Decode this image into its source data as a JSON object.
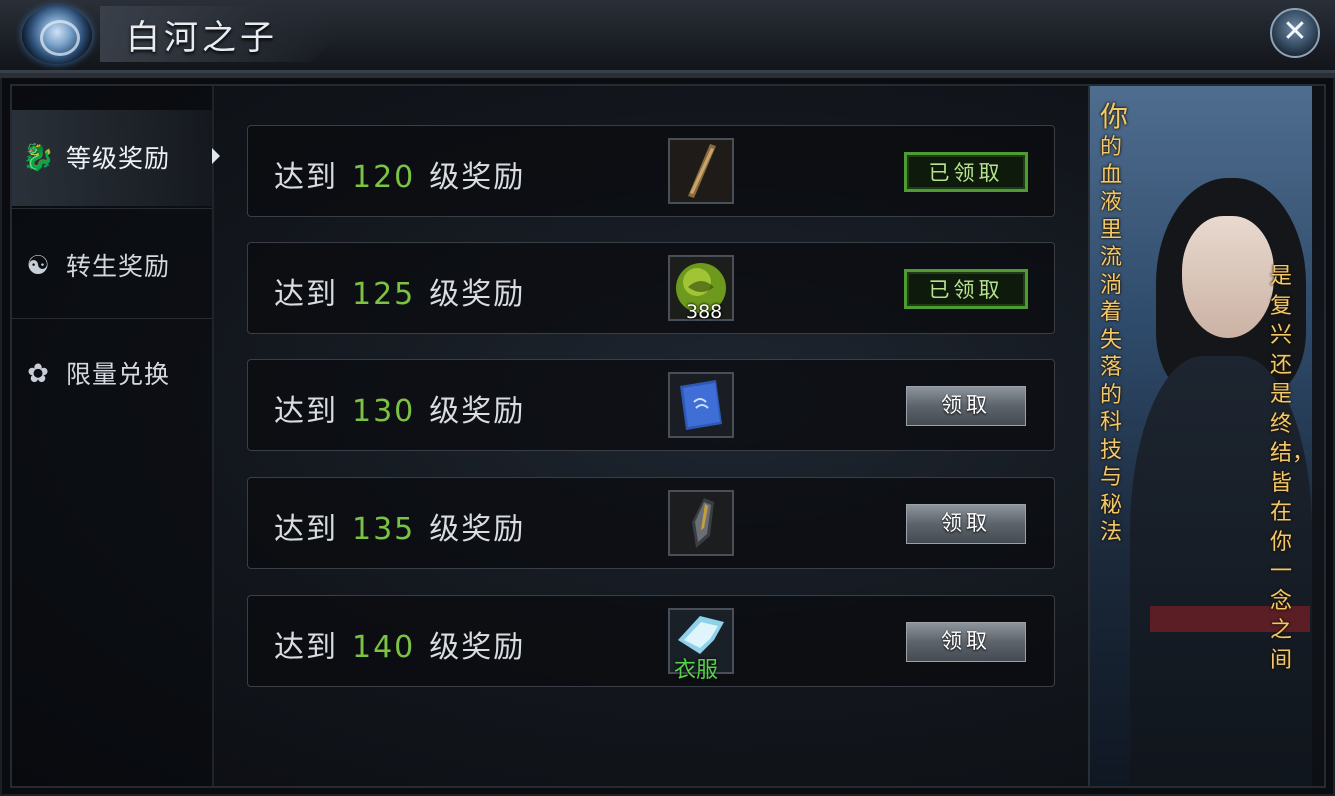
{
  "window": {
    "title": "白河之子",
    "close_label": "✕"
  },
  "sidebar": {
    "items": [
      {
        "label": "等级奖励",
        "icon": "dragon-icon",
        "active": true
      },
      {
        "label": "转生奖励",
        "icon": "swirl-icon",
        "active": false
      },
      {
        "label": "限量兑换",
        "icon": "flower-icon",
        "active": false
      }
    ]
  },
  "rewards": [
    {
      "prefix": "达到",
      "level": "120",
      "suffix": "级奖励",
      "item": "staff-item-icon",
      "qty": "",
      "tag": "",
      "button": "已领取",
      "claimed": true
    },
    {
      "prefix": "达到",
      "level": "125",
      "suffix": "级奖励",
      "item": "green-orb-item-icon",
      "qty": "388",
      "tag": "",
      "button": "已领取",
      "claimed": true
    },
    {
      "prefix": "达到",
      "level": "130",
      "suffix": "级奖励",
      "item": "blue-book-item-icon",
      "qty": "",
      "tag": "",
      "button": "领取",
      "claimed": false
    },
    {
      "prefix": "达到",
      "level": "135",
      "suffix": "级奖励",
      "item": "armor-item-icon",
      "qty": "",
      "tag": "",
      "button": "领取",
      "claimed": false
    },
    {
      "prefix": "达到",
      "level": "140",
      "suffix": "级奖励",
      "item": "clothes-item-icon",
      "qty": "",
      "tag": "衣服",
      "button": "领取",
      "claimed": false
    }
  ],
  "banner": {
    "left_first": "你",
    "left_rest": "的血液里流淌着失落的科技与秘法",
    "right_text": "是复兴还是终结，皆在你一念之间"
  },
  "colors": {
    "level_green": "#7cc243",
    "banner_gold": "#f2c86a",
    "claimed_border": "#4e9a33"
  }
}
